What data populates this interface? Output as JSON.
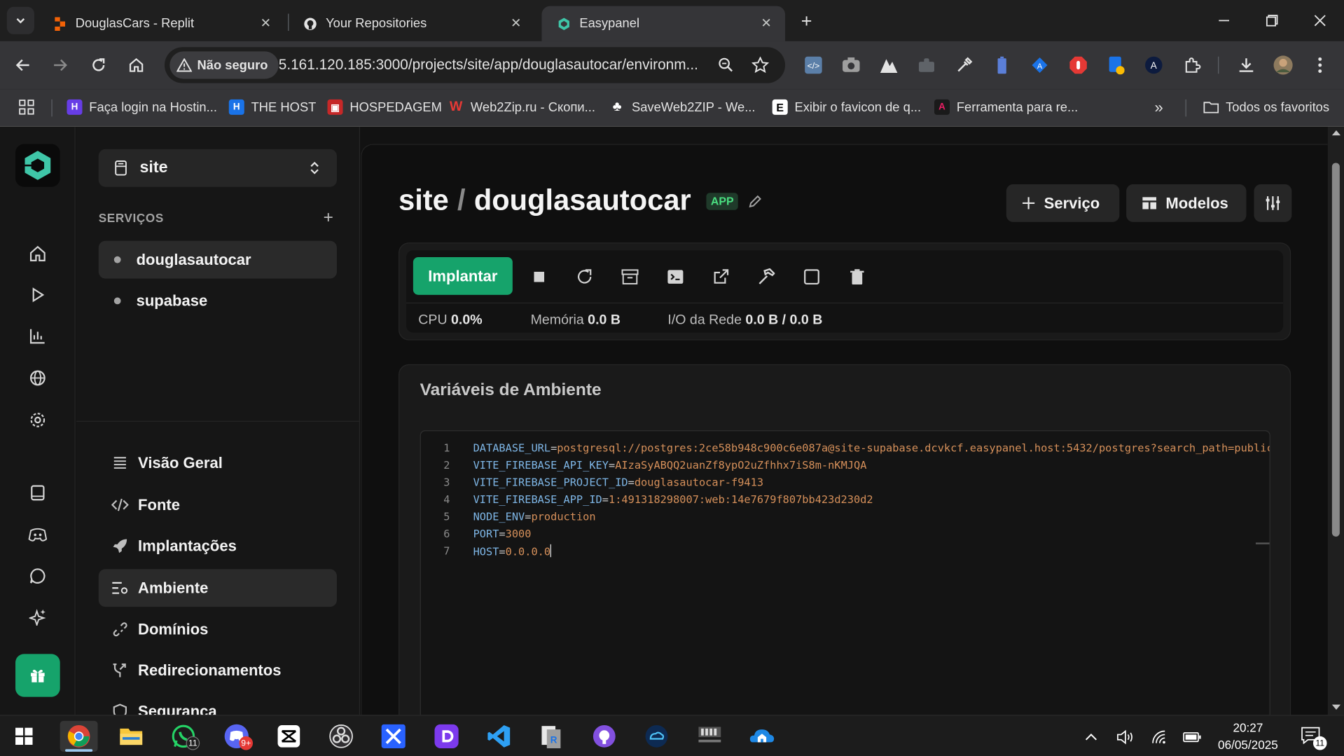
{
  "browser": {
    "tabs": [
      {
        "title": "DouglasCars - Replit",
        "favicon": "replit-icon"
      },
      {
        "title": "Your Repositories",
        "favicon": "github-icon"
      },
      {
        "title": "Easypanel",
        "favicon": "easypanel-icon"
      }
    ],
    "security_label": "Não seguro",
    "url": "5.161.120.185:3000/projects/site/app/douglasautocar/environm...",
    "bookmarks": [
      {
        "label": "Faça login na Hostin...",
        "color": "#673de6"
      },
      {
        "label": "THE HOST",
        "color": "#1a73e8"
      },
      {
        "label": "HOSPEDAGEM",
        "color": "#c62828"
      },
      {
        "label": "Web2Zip.ru - Скопи...",
        "color": "#e53935"
      },
      {
        "label": "SaveWeb2ZIP - We...",
        "color": "#000000"
      },
      {
        "label": "Exibir o favicon de q...",
        "color": "#ffffff"
      },
      {
        "label": "Ferramenta para re...",
        "color": "#7b1fa2"
      }
    ],
    "all_bookmarks_label": "Todos os favoritos"
  },
  "sidebar": {
    "project": "site",
    "services_header": "SERVIÇOS",
    "services": [
      "douglasautocar",
      "supabase"
    ],
    "menu": [
      "Visão Geral",
      "Fonte",
      "Implantações",
      "Ambiente",
      "Domínios",
      "Redirecionamentos",
      "Segurança"
    ],
    "selected_menu": "Ambiente"
  },
  "header": {
    "project": "site",
    "service": "douglasautocar",
    "badge": "APP",
    "add_service_label": "Serviço",
    "templates_label": "Modelos"
  },
  "actions": {
    "deploy_label": "Implantar",
    "cpu_label": "CPU",
    "cpu_value": "0.0%",
    "memory_label": "Memória",
    "memory_value": "0.0 B",
    "network_label": "I/O da Rede",
    "network_value": "0.0 B / 0.0 B"
  },
  "env": {
    "title": "Variáveis de Ambiente",
    "lines": [
      {
        "n": "1",
        "key": "DATABASE_URL",
        "value": "postgresql://postgres:2ce58b948c900c6e087a@site-supabase.dcvkcf.easypanel.host:5432/postgres?search_path=public"
      },
      {
        "n": "2",
        "key": "VITE_FIREBASE_API_KEY",
        "value": "AIzaSyABQQ2uanZf8ypO2uZfhhx7iS8m-nKMJQA"
      },
      {
        "n": "3",
        "key": "VITE_FIREBASE_PROJECT_ID",
        "value": "douglasautocar-f9413"
      },
      {
        "n": "4",
        "key": "VITE_FIREBASE_APP_ID",
        "value": "1:491318298007:web:14e7679f807bb423d230d2"
      },
      {
        "n": "5",
        "key": "NODE_ENV",
        "value": "production"
      },
      {
        "n": "6",
        "key": "PORT",
        "value": "3000"
      },
      {
        "n": "7",
        "key": "HOST",
        "value": "0.0.0.0"
      }
    ]
  },
  "taskbar": {
    "whatsapp_badge": "11",
    "discord_badge": "9+",
    "time": "20:27",
    "date": "06/05/2025",
    "notifications": "11"
  },
  "colors": {
    "accent": "#16a36b",
    "env_key": "#7eb6e6",
    "env_value": "#d6905a"
  }
}
